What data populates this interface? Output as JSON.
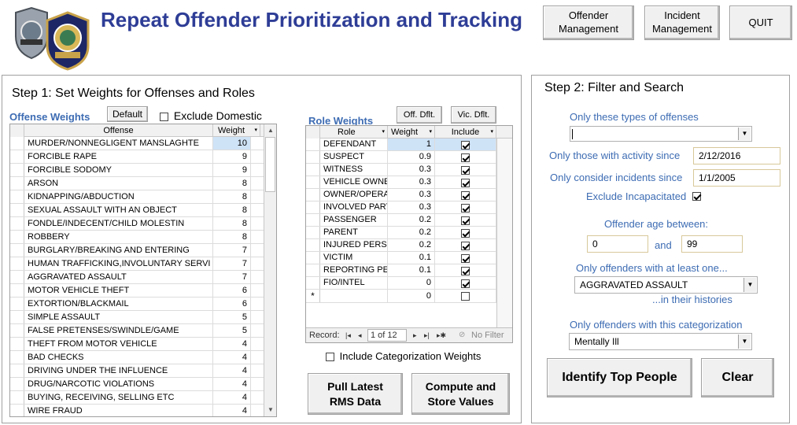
{
  "header": {
    "title": "Repeat Offender Prioritization and Tracking",
    "buttons": {
      "offender_management": "Offender Management",
      "incident_management": "Incident Management",
      "quit": "QUIT"
    }
  },
  "step1": {
    "title": "Step 1: Set Weights for Offenses and Roles",
    "offense_weights_label": "Offense Weights",
    "default_button": "Default",
    "exclude_domestic_label": "Exclude Domestic",
    "exclude_domestic_checked": false,
    "offense_columns": {
      "offense": "Offense",
      "weight": "Weight"
    },
    "offenses": [
      {
        "name": "MURDER/NONNEGLIGENT MANSLAGHTE",
        "weight": "10"
      },
      {
        "name": "FORCIBLE RAPE",
        "weight": "9"
      },
      {
        "name": "FORCIBLE SODOMY",
        "weight": "9"
      },
      {
        "name": "ARSON",
        "weight": "8"
      },
      {
        "name": "KIDNAPPING/ABDUCTION",
        "weight": "8"
      },
      {
        "name": "SEXUAL ASSAULT WITH AN OBJECT",
        "weight": "8"
      },
      {
        "name": "FONDLE/INDECENT/CHILD MOLESTIN",
        "weight": "8"
      },
      {
        "name": "ROBBERY",
        "weight": "8"
      },
      {
        "name": "BURGLARY/BREAKING AND ENTERING",
        "weight": "7"
      },
      {
        "name": "HUMAN TRAFFICKING,INVOLUNTARY SERVI",
        "weight": "7"
      },
      {
        "name": "AGGRAVATED ASSAULT",
        "weight": "7"
      },
      {
        "name": "MOTOR VEHICLE THEFT",
        "weight": "6"
      },
      {
        "name": "EXTORTION/BLACKMAIL",
        "weight": "6"
      },
      {
        "name": "SIMPLE ASSAULT",
        "weight": "5"
      },
      {
        "name": "FALSE PRETENSES/SWINDLE/GAME",
        "weight": "5"
      },
      {
        "name": "THEFT FROM MOTOR VEHICLE",
        "weight": "4"
      },
      {
        "name": "BAD CHECKS",
        "weight": "4"
      },
      {
        "name": "DRIVING UNDER THE INFLUENCE",
        "weight": "4"
      },
      {
        "name": "DRUG/NARCOTIC VIOLATIONS",
        "weight": "4"
      },
      {
        "name": "BUYING, RECEIVING, SELLING ETC",
        "weight": "4"
      },
      {
        "name": "WIRE FRAUD",
        "weight": "4"
      }
    ],
    "role_weights_label": "Role Weights",
    "off_default_button": "Off. Dflt.",
    "vic_default_button": "Vic. Dflt.",
    "role_columns": {
      "role": "Role",
      "weight": "Weight",
      "include": "Include"
    },
    "roles": [
      {
        "role": "DEFENDANT",
        "weight": "1",
        "include": true
      },
      {
        "role": "SUSPECT",
        "weight": "0.9",
        "include": true
      },
      {
        "role": "WITNESS",
        "weight": "0.3",
        "include": true
      },
      {
        "role": "VEHICLE OWNEF",
        "weight": "0.3",
        "include": true
      },
      {
        "role": "OWNER/OPERAT",
        "weight": "0.3",
        "include": true
      },
      {
        "role": "INVOLVED PART",
        "weight": "0.3",
        "include": true
      },
      {
        "role": "PASSENGER",
        "weight": "0.2",
        "include": true
      },
      {
        "role": "PARENT",
        "weight": "0.2",
        "include": true
      },
      {
        "role": "INJURED PERSO",
        "weight": "0.2",
        "include": true
      },
      {
        "role": "VICTIM",
        "weight": "0.1",
        "include": true
      },
      {
        "role": "REPORTING PER",
        "weight": "0.1",
        "include": true
      },
      {
        "role": "FIO/INTEL",
        "weight": "0",
        "include": true
      }
    ],
    "new_row": {
      "marker": "*",
      "weight": "0"
    },
    "record_nav": {
      "label": "Record:",
      "position": "1 of 12",
      "no_filter": "No Filter"
    },
    "include_categorization_label": "Include Categorization Weights",
    "include_categorization_checked": false,
    "pull_rms_button": "Pull Latest RMS Data",
    "compute_button": "Compute and Store Values"
  },
  "step2": {
    "title": "Step 2: Filter and Search",
    "offense_types_label": "Only these types of offenses",
    "offense_types_value": "",
    "activity_since_label": "Only those with activity since",
    "activity_since_value": "2/12/2016",
    "incidents_since_label": "Only consider incidents since",
    "incidents_since_value": "1/1/2005",
    "exclude_incapacitated_label": "Exclude Incapacitated",
    "exclude_incapacitated_checked": true,
    "age_label": "Offender age between:",
    "age_min": "0",
    "age_and": "and",
    "age_max": "99",
    "at_least_one_label": "Only offenders with at least one...",
    "at_least_one_value": "AGGRAVATED ASSAULT",
    "in_histories_label": "...in their histories",
    "categorization_label": "Only offenders with this categorization",
    "categorization_value": "Mentally Ill",
    "identify_button": "Identify Top People",
    "clear_button": "Clear"
  },
  "colors": {
    "title_blue": "#2e3d96",
    "label_blue": "#3d6cb3",
    "selection": "#cfe3f7"
  }
}
